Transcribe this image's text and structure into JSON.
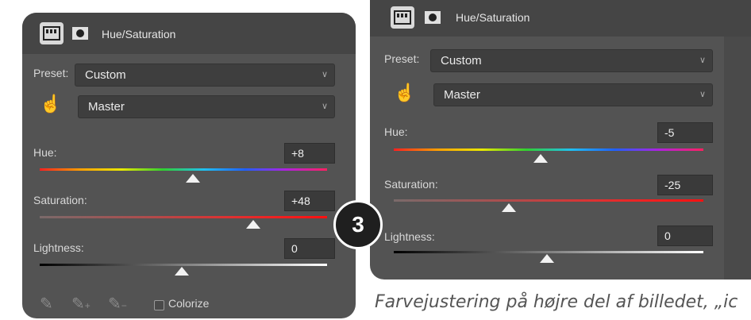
{
  "left_panel": {
    "title": "Hue/Saturation",
    "preset_label": "Preset:",
    "preset_value": "Custom",
    "channel_value": "Master",
    "hue": {
      "label": "Hue:",
      "value": "+8"
    },
    "saturation": {
      "label": "Saturation:",
      "value": "+48"
    },
    "lightness": {
      "label": "Lightness:",
      "value": "0"
    },
    "colorize_label": "Colorize"
  },
  "right_panel": {
    "title": "Hue/Saturation",
    "preset_label": "Preset:",
    "preset_value": "Custom",
    "channel_value": "Master",
    "hue": {
      "label": "Hue:",
      "value": "-5"
    },
    "saturation": {
      "label": "Saturation:",
      "value": "-25"
    },
    "lightness": {
      "label": "Lightness:",
      "value": "0"
    }
  },
  "step_badge": "3",
  "caption": "Farvejustering på højre del af billedet, „ic"
}
